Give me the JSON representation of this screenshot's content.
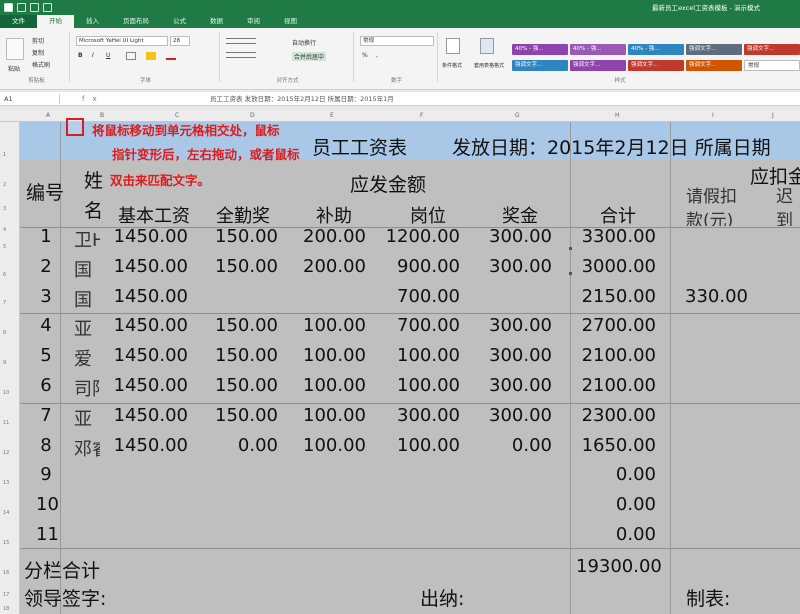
{
  "window": {
    "doc_title": "最新员工excel工资表模板 - 演示模式"
  },
  "ribbon": {
    "tabs": [
      "文件",
      "开始",
      "插入",
      "页面布局",
      "公式",
      "数据",
      "审阅",
      "视图"
    ],
    "active_tab": "开始",
    "paste_label": "粘贴",
    "cut_label": "剪切",
    "copy_label": "复制",
    "format_painter_label": "格式刷",
    "font_name": "Microsoft YaHei UI Light",
    "font_size": "28",
    "bold": "B",
    "italic": "I",
    "underline": "U",
    "group_clipboard": "剪贴板",
    "group_font": "字体",
    "group_alignment": "对齐方式",
    "group_number": "数字",
    "group_styles": "样式",
    "wrap_text_label": "自动换行",
    "merge_center_label": "合并后居中",
    "number_format": "常规",
    "percent_btn": "%",
    "comma_btn": ",",
    "cond_format_label": "条件格式",
    "table_format_label": "套用表格格式",
    "styles": [
      {
        "label": "40% - 强...",
        "color": "#8e44ad"
      },
      {
        "label": "40% - 强...",
        "color": "#9b59b6"
      },
      {
        "label": "40% - 强...",
        "color": "#2e86c1"
      },
      {
        "label": "强调文字...",
        "color": "#5d6d7e"
      },
      {
        "label": "强调文字...",
        "color": "#c0392b"
      },
      {
        "label": "强调文字...",
        "color": "#2e86c1"
      },
      {
        "label": "强调文字...",
        "color": "#8e44ad"
      },
      {
        "label": "强调文字...",
        "color": "#c0392b"
      },
      {
        "label": "强调文字...",
        "color": "#d35400"
      },
      {
        "label": "常规",
        "color": "#ffffff"
      }
    ]
  },
  "formula_bar": {
    "name_box": "A1",
    "fx": "fx",
    "formula": "员工工资表    发放日期：2015年2月12日  所属日期：2015年1月"
  },
  "columns": [
    "A",
    "B",
    "C",
    "D",
    "E",
    "F",
    "G",
    "H",
    "I",
    "J"
  ],
  "rows": [
    "1",
    "2",
    "3",
    "4",
    "5",
    "6",
    "7",
    "8",
    "9",
    "10",
    "11",
    "12",
    "13",
    "14",
    "15",
    "16",
    "17",
    "18"
  ],
  "sheet": {
    "title": "员工工资表",
    "issue_date": "发放日期：2015年2月12日  所属日期",
    "hint_lines": [
      "将鼠标移动到单元格相交处，鼠标",
      "指针变形后，左右拖动，或者鼠标",
      "双击来匹配文字。"
    ],
    "col_num": "编号",
    "col_name_1": "姓",
    "col_name_2": "名",
    "group_payable": "应发金额",
    "group_deduct": "应扣金",
    "sub_headers": [
      "基本工资",
      "全勤奖",
      "补助",
      "岗位",
      "奖金",
      "合计"
    ],
    "leave_hdr_1": "请假扣",
    "leave_hdr_2": "款(元)",
    "misc_hdr_1": "迟",
    "misc_hdr_2": "到",
    "rows": [
      {
        "no": "1",
        "name": "卫H",
        "base": "1450.00",
        "full": "150.00",
        "sub": "200.00",
        "post": "1200.00",
        "bonus": "300.00",
        "total": "3300.00",
        "leave": ""
      },
      {
        "no": "2",
        "name": "国",
        "base": "1450.00",
        "full": "150.00",
        "sub": "200.00",
        "post": "900.00",
        "bonus": "300.00",
        "total": "3000.00",
        "leave": ""
      },
      {
        "no": "3",
        "name": "国",
        "base": "1450.00",
        "full": "",
        "sub": "",
        "post": "700.00",
        "bonus": "",
        "total": "2150.00",
        "leave": "330.00"
      },
      {
        "no": "4",
        "name": "亚",
        "base": "1450.00",
        "full": "150.00",
        "sub": "100.00",
        "post": "700.00",
        "bonus": "300.00",
        "total": "2700.00",
        "leave": ""
      },
      {
        "no": "5",
        "name": "爱",
        "base": "1450.00",
        "full": "150.00",
        "sub": "100.00",
        "post": "100.00",
        "bonus": "300.00",
        "total": "2100.00",
        "leave": ""
      },
      {
        "no": "6",
        "name": "司阳",
        "base": "1450.00",
        "full": "150.00",
        "sub": "100.00",
        "post": "100.00",
        "bonus": "300.00",
        "total": "2100.00",
        "leave": ""
      },
      {
        "no": "7",
        "name": "亚",
        "base": "1450.00",
        "full": "150.00",
        "sub": "100.00",
        "post": "300.00",
        "bonus": "300.00",
        "total": "2300.00",
        "leave": ""
      },
      {
        "no": "8",
        "name": "邓睿",
        "base": "1450.00",
        "full": "0.00",
        "sub": "100.00",
        "post": "100.00",
        "bonus": "0.00",
        "total": "1650.00",
        "leave": ""
      },
      {
        "no": "9",
        "name": "",
        "base": "",
        "full": "",
        "sub": "",
        "post": "",
        "bonus": "",
        "total": "0.00",
        "leave": ""
      },
      {
        "no": "10",
        "name": "",
        "base": "",
        "full": "",
        "sub": "",
        "post": "",
        "bonus": "",
        "total": "0.00",
        "leave": ""
      },
      {
        "no": "11",
        "name": "",
        "base": "",
        "full": "",
        "sub": "",
        "post": "",
        "bonus": "",
        "total": "0.00",
        "leave": ""
      }
    ],
    "subtotal_label": "分栏合计",
    "subtotal_value": "19300.00",
    "leader_sign": "领导签字:",
    "cashier": "出纳:",
    "preparer": "制表:"
  }
}
